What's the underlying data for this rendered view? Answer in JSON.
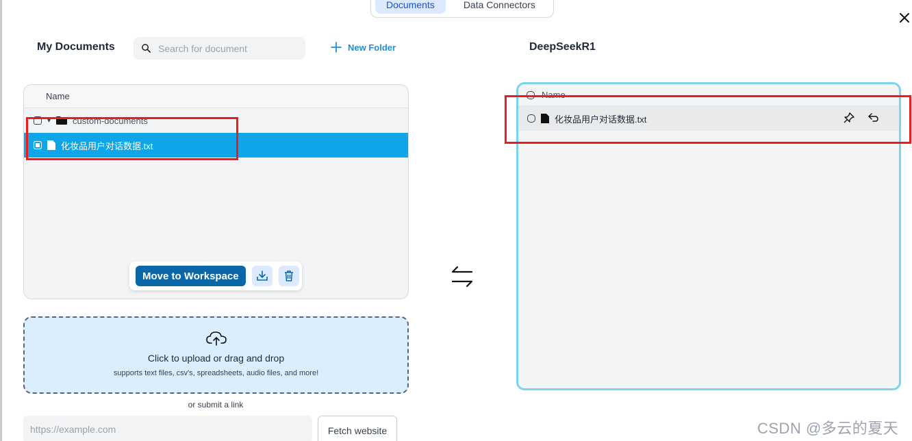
{
  "tabs": [
    {
      "label": "Documents",
      "active": true
    },
    {
      "label": "Data Connectors",
      "active": false
    }
  ],
  "my_documents": {
    "title": "My Documents",
    "search_placeholder": "Search for document",
    "new_folder_label": "New Folder",
    "column_header": "Name",
    "folder": {
      "name": "custom-documents",
      "expanded": true
    },
    "files": [
      {
        "name": "化妆品用户对话数据.txt",
        "selected": true
      }
    ],
    "actions": {
      "move_label": "Move to Workspace",
      "embed_icon": "embed-icon",
      "delete_icon": "trash-icon"
    }
  },
  "upload": {
    "title": "Click to upload or drag and drop",
    "subtitle": "supports text files, csv's, spreadsheets, audio files, and more!",
    "or_link": "or submit a link",
    "url_placeholder": "https://example.com",
    "fetch_label": "Fetch website"
  },
  "workspace": {
    "title": "DeepSeekR1",
    "column_header": "Name",
    "files": [
      {
        "name": "化妆品用户对话数据.txt"
      }
    ]
  },
  "watermark": "CSDN @多云的夏天",
  "colors": {
    "accent": "#0ea5e9",
    "primary_button": "#0b67a8",
    "highlight_red": "#ef1c1c",
    "workspace_border": "#7dd3ee",
    "upload_bg": "#dbeefd"
  }
}
